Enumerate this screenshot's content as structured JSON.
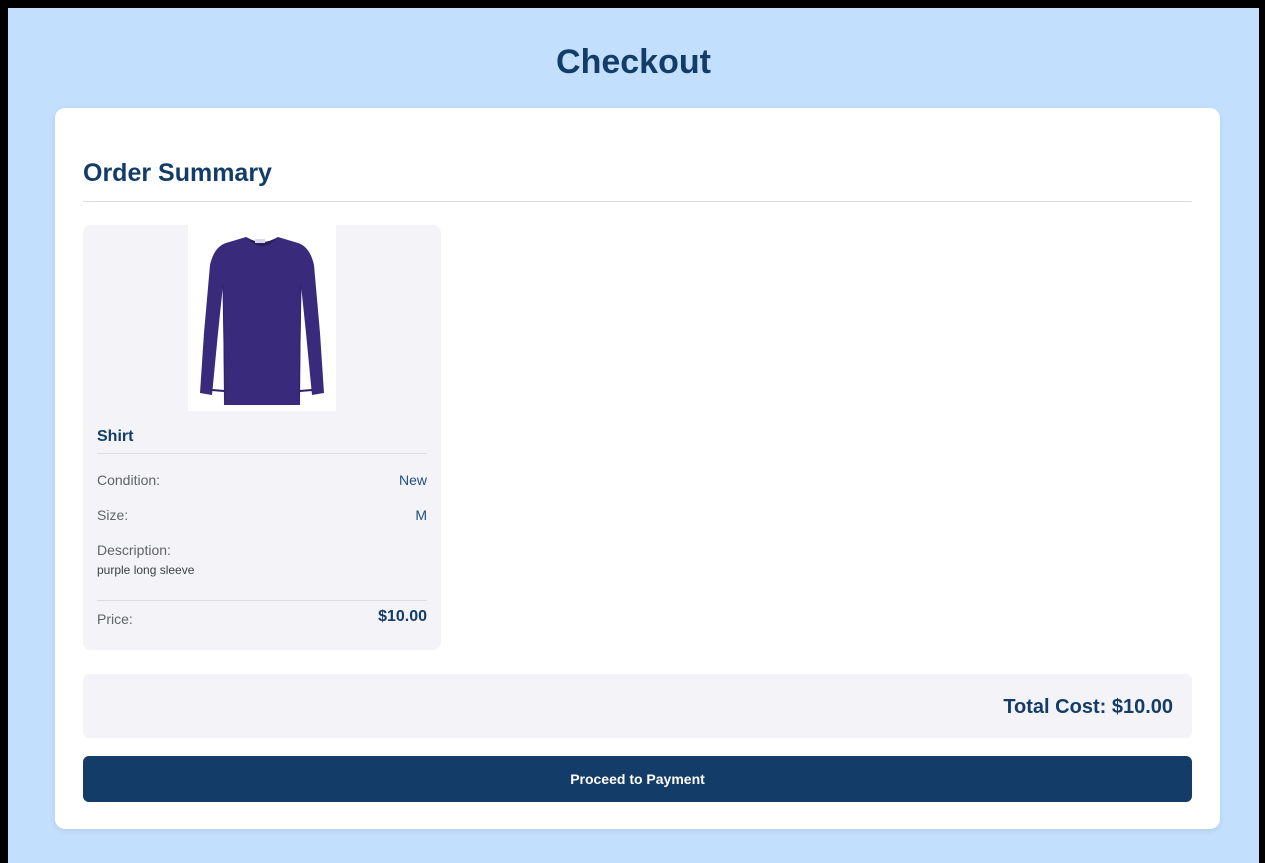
{
  "page": {
    "title": "Checkout"
  },
  "order_summary": {
    "heading": "Order Summary",
    "items": [
      {
        "name": "Shirt",
        "image_icon": "purple-long-sleeve-shirt-image",
        "condition_label": "Condition:",
        "condition_value": "New",
        "size_label": "Size:",
        "size_value": "M",
        "description_label": "Description:",
        "description_value": "purple long sleeve",
        "price_label": "Price:",
        "price_value": "$10.00"
      }
    ],
    "total_label": "Total Cost: $10.00"
  },
  "actions": {
    "proceed_label": "Proceed to Payment"
  },
  "colors": {
    "page_background": "#c2dffd",
    "primary_navy": "#133d68",
    "card_background": "#ffffff",
    "item_background": "#f4f4f8",
    "shirt_purple": "#3a2a7c"
  }
}
